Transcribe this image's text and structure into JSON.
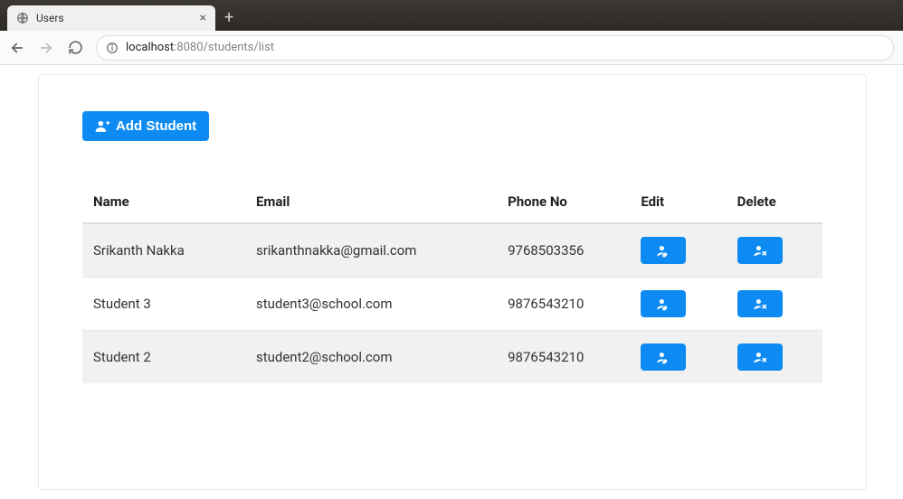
{
  "browser": {
    "tab_title": "Users",
    "url_host": "localhost",
    "url_port_path": ":8080/students/list"
  },
  "page": {
    "add_button_label": "Add Student",
    "columns": {
      "name": "Name",
      "email": "Email",
      "phone": "Phone No",
      "edit": "Edit",
      "delete": "Delete"
    },
    "students": [
      {
        "name": "Srikanth Nakka",
        "email": "srikanthnakka@gmail.com",
        "phone": "9768503356"
      },
      {
        "name": "Student 3",
        "email": "student3@school.com",
        "phone": "9876543210"
      },
      {
        "name": "Student 2",
        "email": "student2@school.com",
        "phone": "9876543210"
      }
    ]
  },
  "colors": {
    "primary": "#0d8bf2"
  }
}
